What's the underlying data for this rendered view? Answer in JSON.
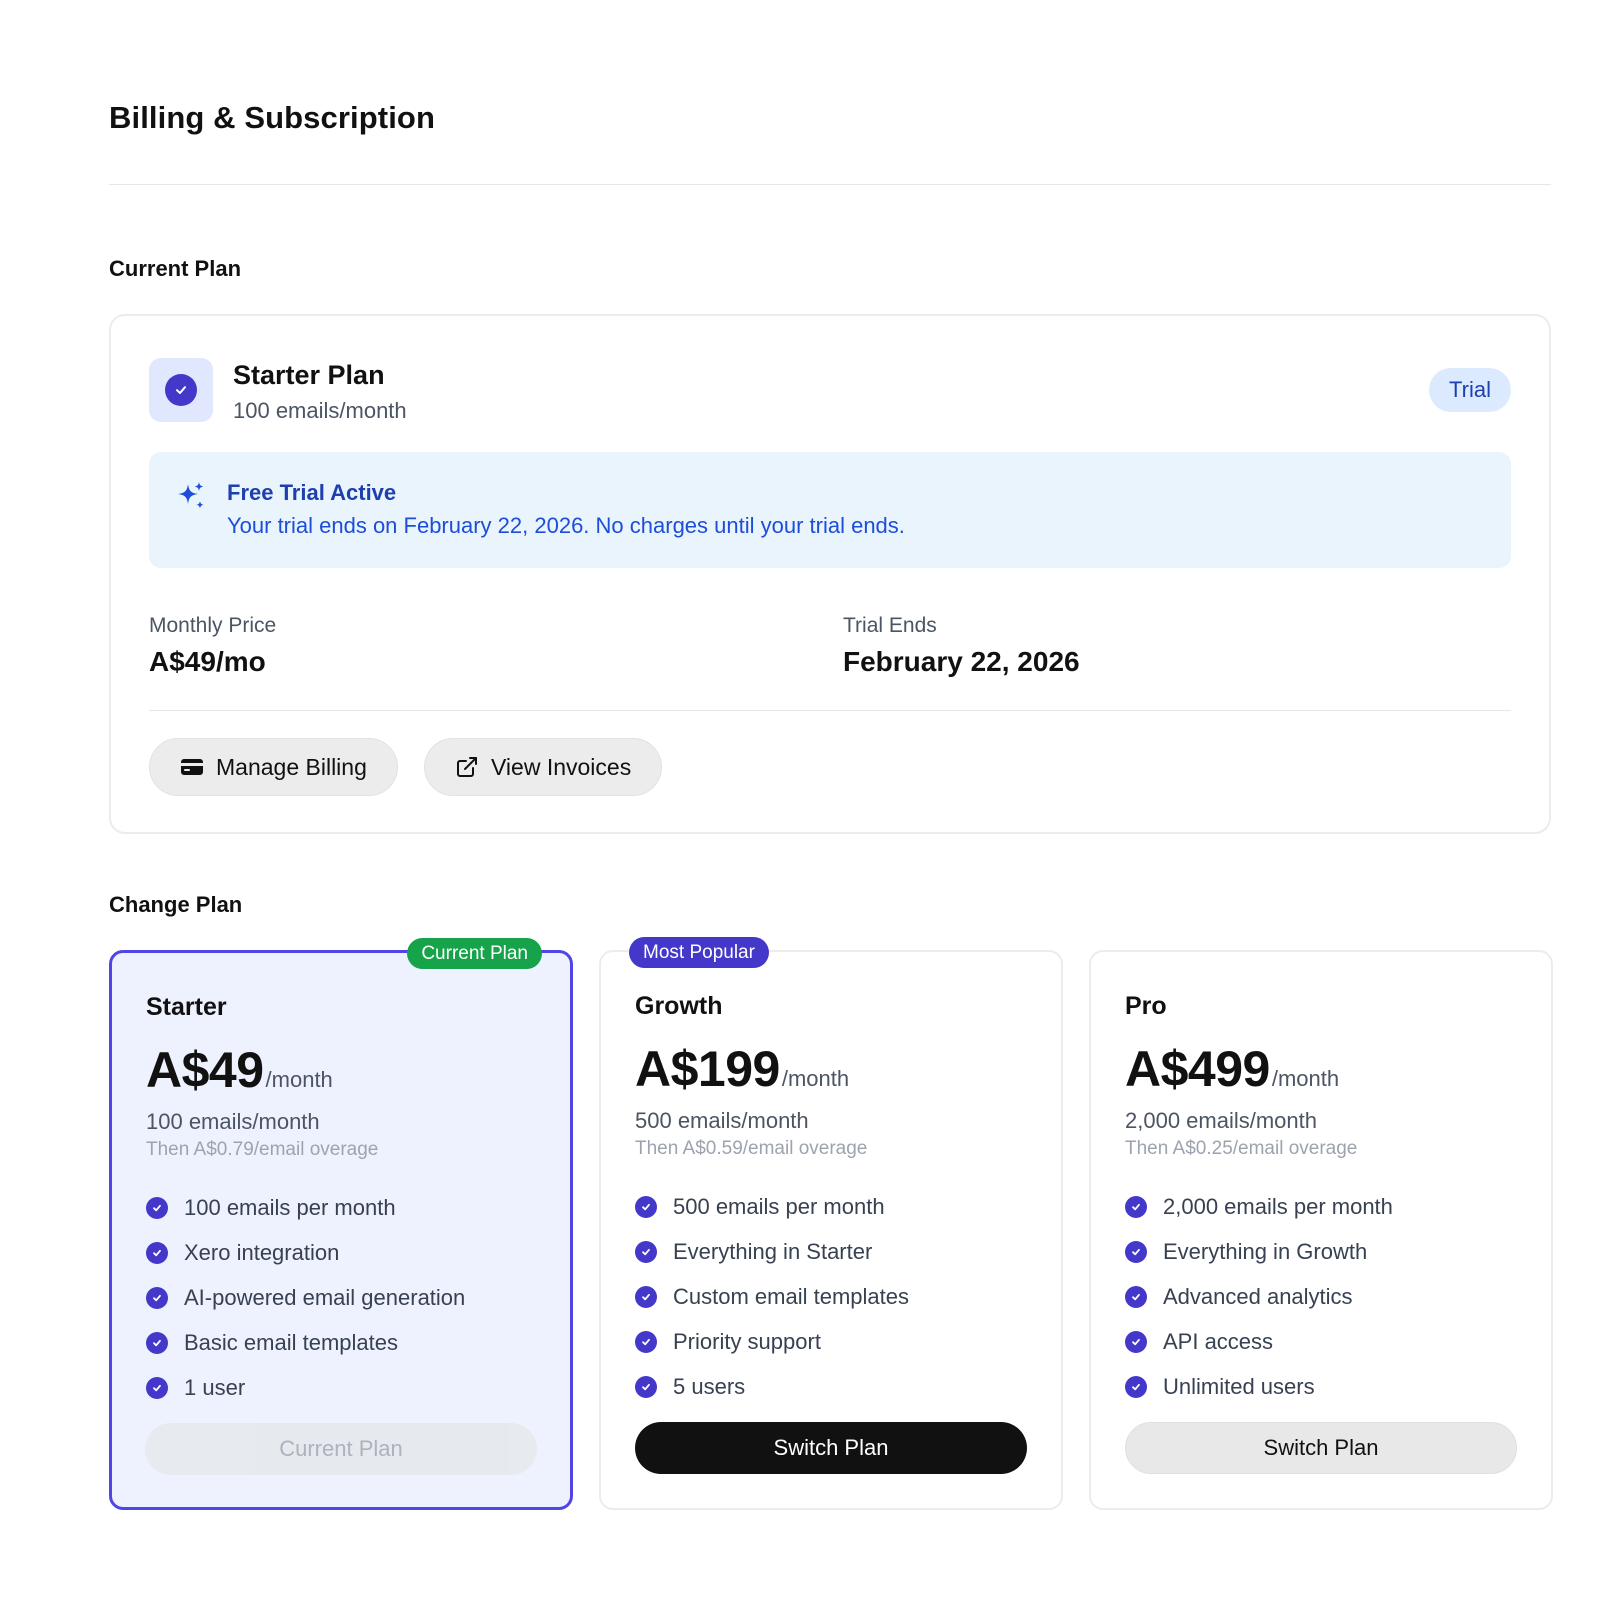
{
  "page": {
    "title": "Billing & Subscription"
  },
  "current_plan": {
    "section_label": "Current Plan",
    "name": "Starter Plan",
    "subtitle": "100 emails/month",
    "badge": "Trial",
    "banner": {
      "title": "Free Trial Active",
      "text": "Your trial ends on February 22, 2026. No charges until your trial ends."
    },
    "monthly_price_label": "Monthly Price",
    "monthly_price_value": "A$49/mo",
    "trial_ends_label": "Trial Ends",
    "trial_ends_value": "February 22, 2026",
    "manage_billing_label": "Manage Billing",
    "view_invoices_label": "View Invoices"
  },
  "change_plan": {
    "section_label": "Change Plan",
    "plans": [
      {
        "ribbon": "Current Plan",
        "name": "Starter",
        "price": "A$49",
        "period": "/month",
        "quota": "100 emails/month",
        "overage": "Then A$0.79/email overage",
        "features": [
          "100 emails per month",
          "Xero integration",
          "AI-powered email generation",
          "Basic email templates",
          "1 user"
        ],
        "cta": "Current Plan"
      },
      {
        "ribbon": "Most Popular",
        "name": "Growth",
        "price": "A$199",
        "period": "/month",
        "quota": "500 emails/month",
        "overage": "Then A$0.59/email overage",
        "features": [
          "500 emails per month",
          "Everything in Starter",
          "Custom email templates",
          "Priority support",
          "5 users"
        ],
        "cta": "Switch Plan"
      },
      {
        "name": "Pro",
        "price": "A$499",
        "period": "/month",
        "quota": "2,000 emails/month",
        "overage": "Then A$0.25/email overage",
        "features": [
          "2,000 emails per month",
          "Everything in Growth",
          "Advanced analytics",
          "API access",
          "Unlimited users"
        ],
        "cta": "Switch Plan"
      }
    ]
  },
  "icons": {
    "plan": "check-circle-icon",
    "banner": "sparkles-icon",
    "manage_billing": "credit-card-icon",
    "view_invoices": "external-link-icon",
    "feature": "check-circle-icon"
  },
  "colors": {
    "accent": "#4338ca",
    "active_border": "#4f46e5",
    "active_bg": "#eef2ff",
    "current_ribbon": "#16a34a",
    "banner_bg": "#eaf4fd",
    "banner_text": "#1d4ed8"
  }
}
